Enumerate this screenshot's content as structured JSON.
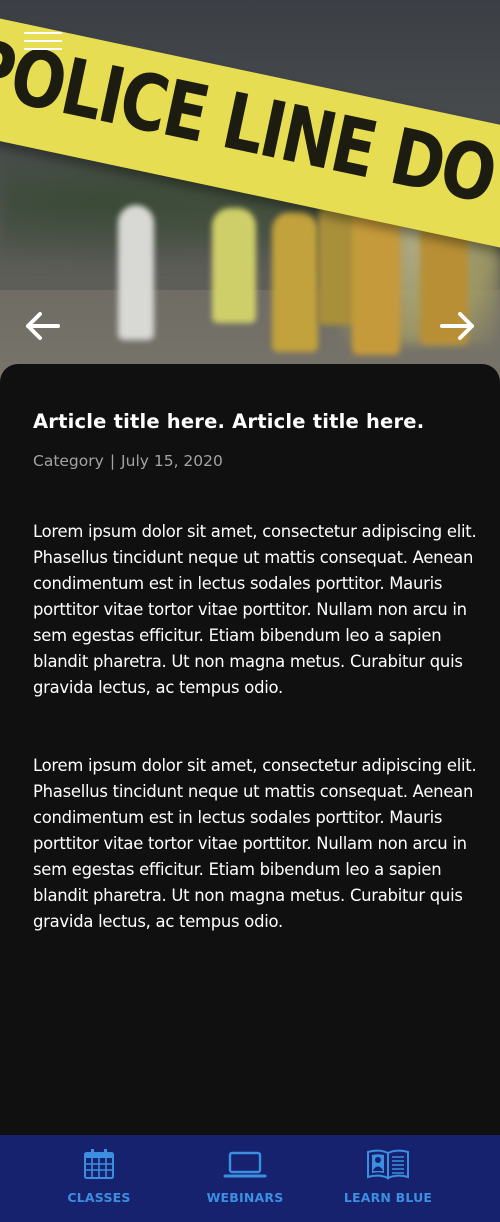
{
  "hero": {
    "tape_text": "POLICE LINE DO NOT CROSS",
    "menu_icon": "hamburger-menu-icon",
    "prev_icon": "arrow-left-icon",
    "next_icon": "arrow-right-icon"
  },
  "article": {
    "title": "Article title here. Article title here.",
    "category": "Category",
    "separator": "|",
    "date": "July 15, 2020",
    "paragraphs": [
      "Lorem ipsum dolor sit amet, consectetur adipiscing elit. Phasellus tincidunt neque ut mattis consequat. Aenean condimentum est in lectus sodales porttitor. Mauris porttitor vitae tortor vitae porttitor. Nullam non arcu in sem egestas efficitur. Etiam bibendum leo a sapien blandit pharetra. Ut non magna metus. Curabitur quis gravida lectus, ac tempus odio.",
      "Lorem ipsum dolor sit amet, consectetur adipiscing elit. Phasellus tincidunt neque ut mattis consequat. Aenean condimentum est in lectus sodales porttitor. Mauris porttitor vitae tortor vitae porttitor. Nullam non arcu in sem egestas efficitur. Etiam bibendum leo a sapien blandit pharetra. Ut non magna metus. Curabitur quis gravida lectus, ac tempus odio."
    ]
  },
  "nav": {
    "items": [
      {
        "label": "CLASSES",
        "icon": "calendar-icon"
      },
      {
        "label": "WEBINARS",
        "icon": "laptop-icon"
      },
      {
        "label": "LEARN BLUE",
        "icon": "book-icon"
      }
    ]
  },
  "colors": {
    "background": "#101010",
    "nav_background": "#16226e",
    "nav_accent": "#3b8ee0",
    "tape": "#e6dd52",
    "meta_text": "#a3a3a3"
  }
}
